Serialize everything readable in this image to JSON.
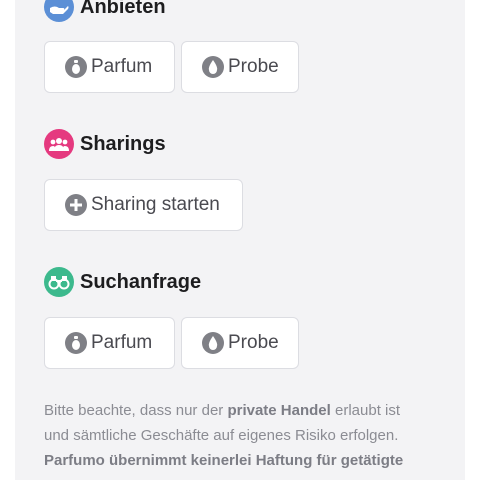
{
  "sections": {
    "anbieten": {
      "title": "Anbieten",
      "icon": "hand-offer-icon",
      "icon_color": "#5b8fd6",
      "buttons": [
        {
          "label": "Parfum",
          "icon": "perfume-bottle-icon"
        },
        {
          "label": "Probe",
          "icon": "drop-icon"
        }
      ]
    },
    "sharings": {
      "title": "Sharings",
      "icon": "group-icon",
      "icon_color": "#e5397f",
      "buttons": [
        {
          "label": "Sharing starten",
          "icon": "plus-circle-icon"
        }
      ]
    },
    "suchanfrage": {
      "title": "Suchanfrage",
      "icon": "binoculars-icon",
      "icon_color": "#3cb98d",
      "buttons": [
        {
          "label": "Parfum",
          "icon": "perfume-bottle-icon"
        },
        {
          "label": "Probe",
          "icon": "drop-icon"
        }
      ]
    }
  },
  "note": {
    "part1": "Bitte beachte, dass nur der ",
    "bold1": "private Handel",
    "part2": " erlaubt ist und sämtliche Geschäfte auf eigenes Risiko erfolgen. ",
    "bold2": "Parfumo übernimmt keinerlei Haftung für getätigte"
  },
  "colors": {
    "panel_bg": "#f3f3f5",
    "icon_gray": "#7f8086"
  }
}
